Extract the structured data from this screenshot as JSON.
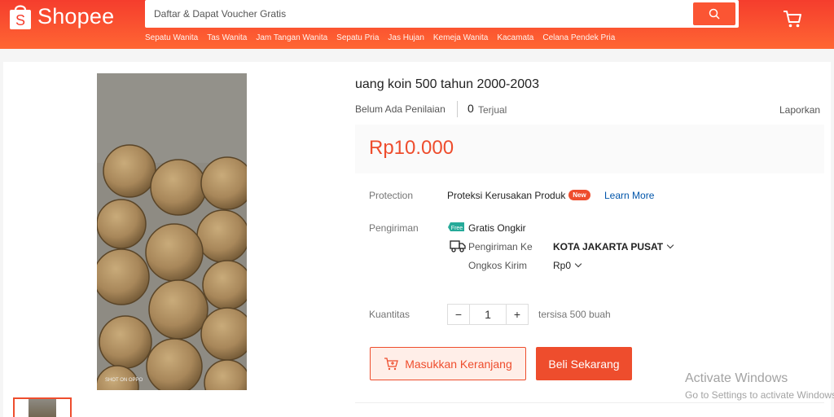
{
  "header": {
    "logo_text": "Shopee",
    "search_placeholder": "Daftar & Dapat Voucher Gratis",
    "suggestions": [
      "Sepatu Wanita",
      "Tas Wanita",
      "Jam Tangan Wanita",
      "Sepatu Pria",
      "Jas Hujan",
      "Kemeja Wanita",
      "Kacamata",
      "Celana Pendek Pria"
    ]
  },
  "product": {
    "title": "uang koin 500 tahun 2000-2003",
    "rating_text": "Belum Ada Penilaian",
    "sold_count": "0",
    "sold_label": "Terjual",
    "report_label": "Laporkan",
    "price": "Rp10.000",
    "image_watermark": "SHOT ON OPPO"
  },
  "details": {
    "protection_label": "Protection",
    "protection_value": "Proteksi Kerusakan Produk",
    "new_badge": "New",
    "learn_more": "Learn More",
    "shipping_label": "Pengiriman",
    "free_shipping": "Gratis Ongkir",
    "free_icon_text": "Free",
    "ship_to_label": "Pengiriman Ke",
    "ship_to_value": "KOTA JAKARTA PUSAT",
    "cost_label": "Ongkos Kirim",
    "cost_value": "Rp0",
    "quantity_label": "Kuantitas",
    "quantity_value": "1",
    "minus": "−",
    "plus": "+",
    "stock_text": "tersisa 500 buah"
  },
  "actions": {
    "add_to_cart": "Masukkan Keranjang",
    "buy_now": "Beli Sekarang"
  },
  "os_overlay": {
    "line1": "Activate Windows",
    "line2": "Go to Settings to activate Windows."
  },
  "colors": {
    "brand": "#ee4d2d",
    "header": "#f53d2d",
    "link": "#0055aa"
  }
}
